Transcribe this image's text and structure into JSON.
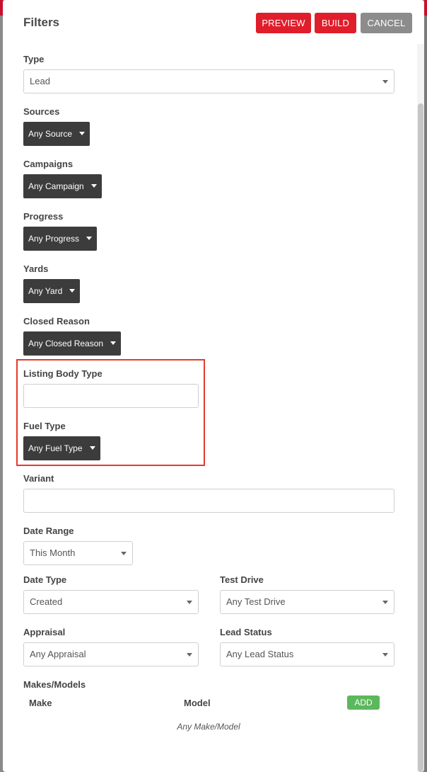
{
  "header": {
    "title": "Filters",
    "preview_label": "PREVIEW",
    "build_label": "BUILD",
    "cancel_label": "CANCEL"
  },
  "fields": {
    "type": {
      "label": "Type",
      "value": "Lead"
    },
    "sources": {
      "label": "Sources",
      "value": "Any Source"
    },
    "campaigns": {
      "label": "Campaigns",
      "value": "Any Campaign"
    },
    "progress": {
      "label": "Progress",
      "value": "Any Progress"
    },
    "yards": {
      "label": "Yards",
      "value": "Any Yard"
    },
    "closed_reason": {
      "label": "Closed Reason",
      "value": "Any Closed Reason"
    },
    "listing_body_type": {
      "label": "Listing Body Type",
      "value": ""
    },
    "fuel_type": {
      "label": "Fuel Type",
      "value": "Any Fuel Type"
    },
    "variant": {
      "label": "Variant",
      "value": ""
    },
    "date_range": {
      "label": "Date Range",
      "value": "This Month"
    },
    "date_type": {
      "label": "Date Type",
      "value": "Created"
    },
    "test_drive": {
      "label": "Test Drive",
      "value": "Any Test Drive"
    },
    "appraisal": {
      "label": "Appraisal",
      "value": "Any Appraisal"
    },
    "lead_status": {
      "label": "Lead Status",
      "value": "Any Lead Status"
    }
  },
  "makes_models": {
    "label": "Makes/Models",
    "columns": [
      "Make",
      "Model"
    ],
    "add_label": "ADD",
    "empty_text": "Any Make/Model"
  },
  "colors": {
    "accent": "#e01e2b",
    "cancel": "#8c8c8c",
    "dropdown_dark": "#3c3c3c",
    "add": "#5cb85c",
    "highlight": "#e8382b"
  }
}
